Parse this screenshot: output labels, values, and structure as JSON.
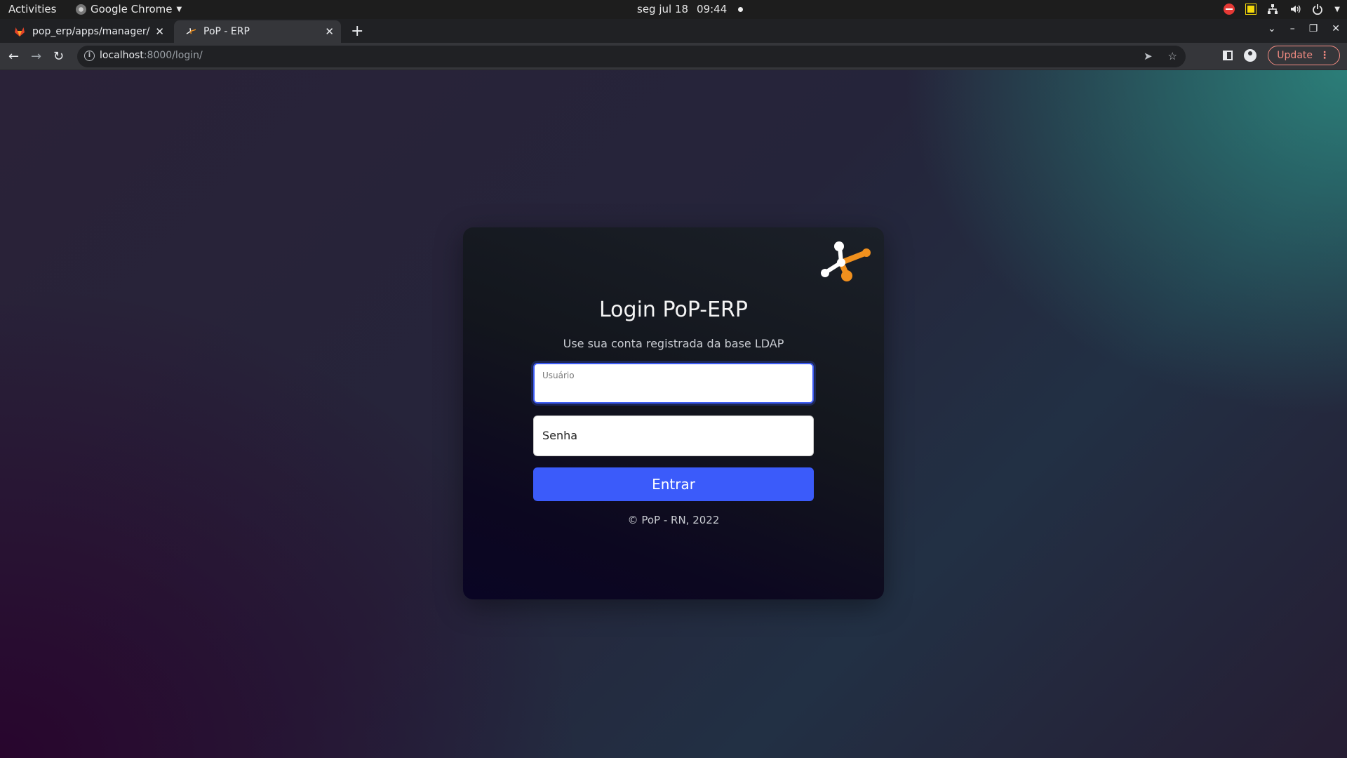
{
  "system_bar": {
    "activities": "Activities",
    "app_name": "Google Chrome",
    "date": "seg jul 18",
    "time": "09:44"
  },
  "tabs": [
    {
      "title": "pop_erp/apps/manager/",
      "active": false,
      "icon": "gitlab-icon"
    },
    {
      "title": "PoP - ERP",
      "active": true,
      "icon": "pop-erp-icon"
    }
  ],
  "toolbar": {
    "url_host": "localhost",
    "url_rest": ":8000/login/",
    "update_label": "Update"
  },
  "login": {
    "title": "Login PoP-ERP",
    "subtitle": "Use sua conta registrada da base LDAP",
    "username_label": "Usuário",
    "password_placeholder": "Senha",
    "submit_label": "Entrar",
    "footer": "© PoP - RN, 2022"
  },
  "colors": {
    "accent": "#3b5bfa",
    "logo_orange": "#f0901e",
    "update_red": "#f28b82"
  }
}
